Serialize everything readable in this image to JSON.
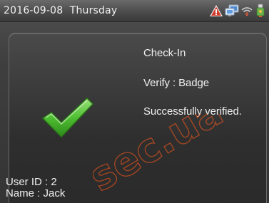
{
  "status_bar": {
    "date": "2016-09-08",
    "weekday": "Thursday",
    "icons": [
      "alarm-warning-icon",
      "network-icon",
      "wifi-icon",
      "usb-icon"
    ]
  },
  "result": {
    "title": "Check-In",
    "verify": "Verify : Badge",
    "message": "Successfully verified.",
    "icon": "checkmark-icon",
    "accent_color": "#4caf3a"
  },
  "user": {
    "id_line": "User ID : 2",
    "name_line": "Name : Jack"
  },
  "watermark": {
    "text": "sec.ua"
  }
}
